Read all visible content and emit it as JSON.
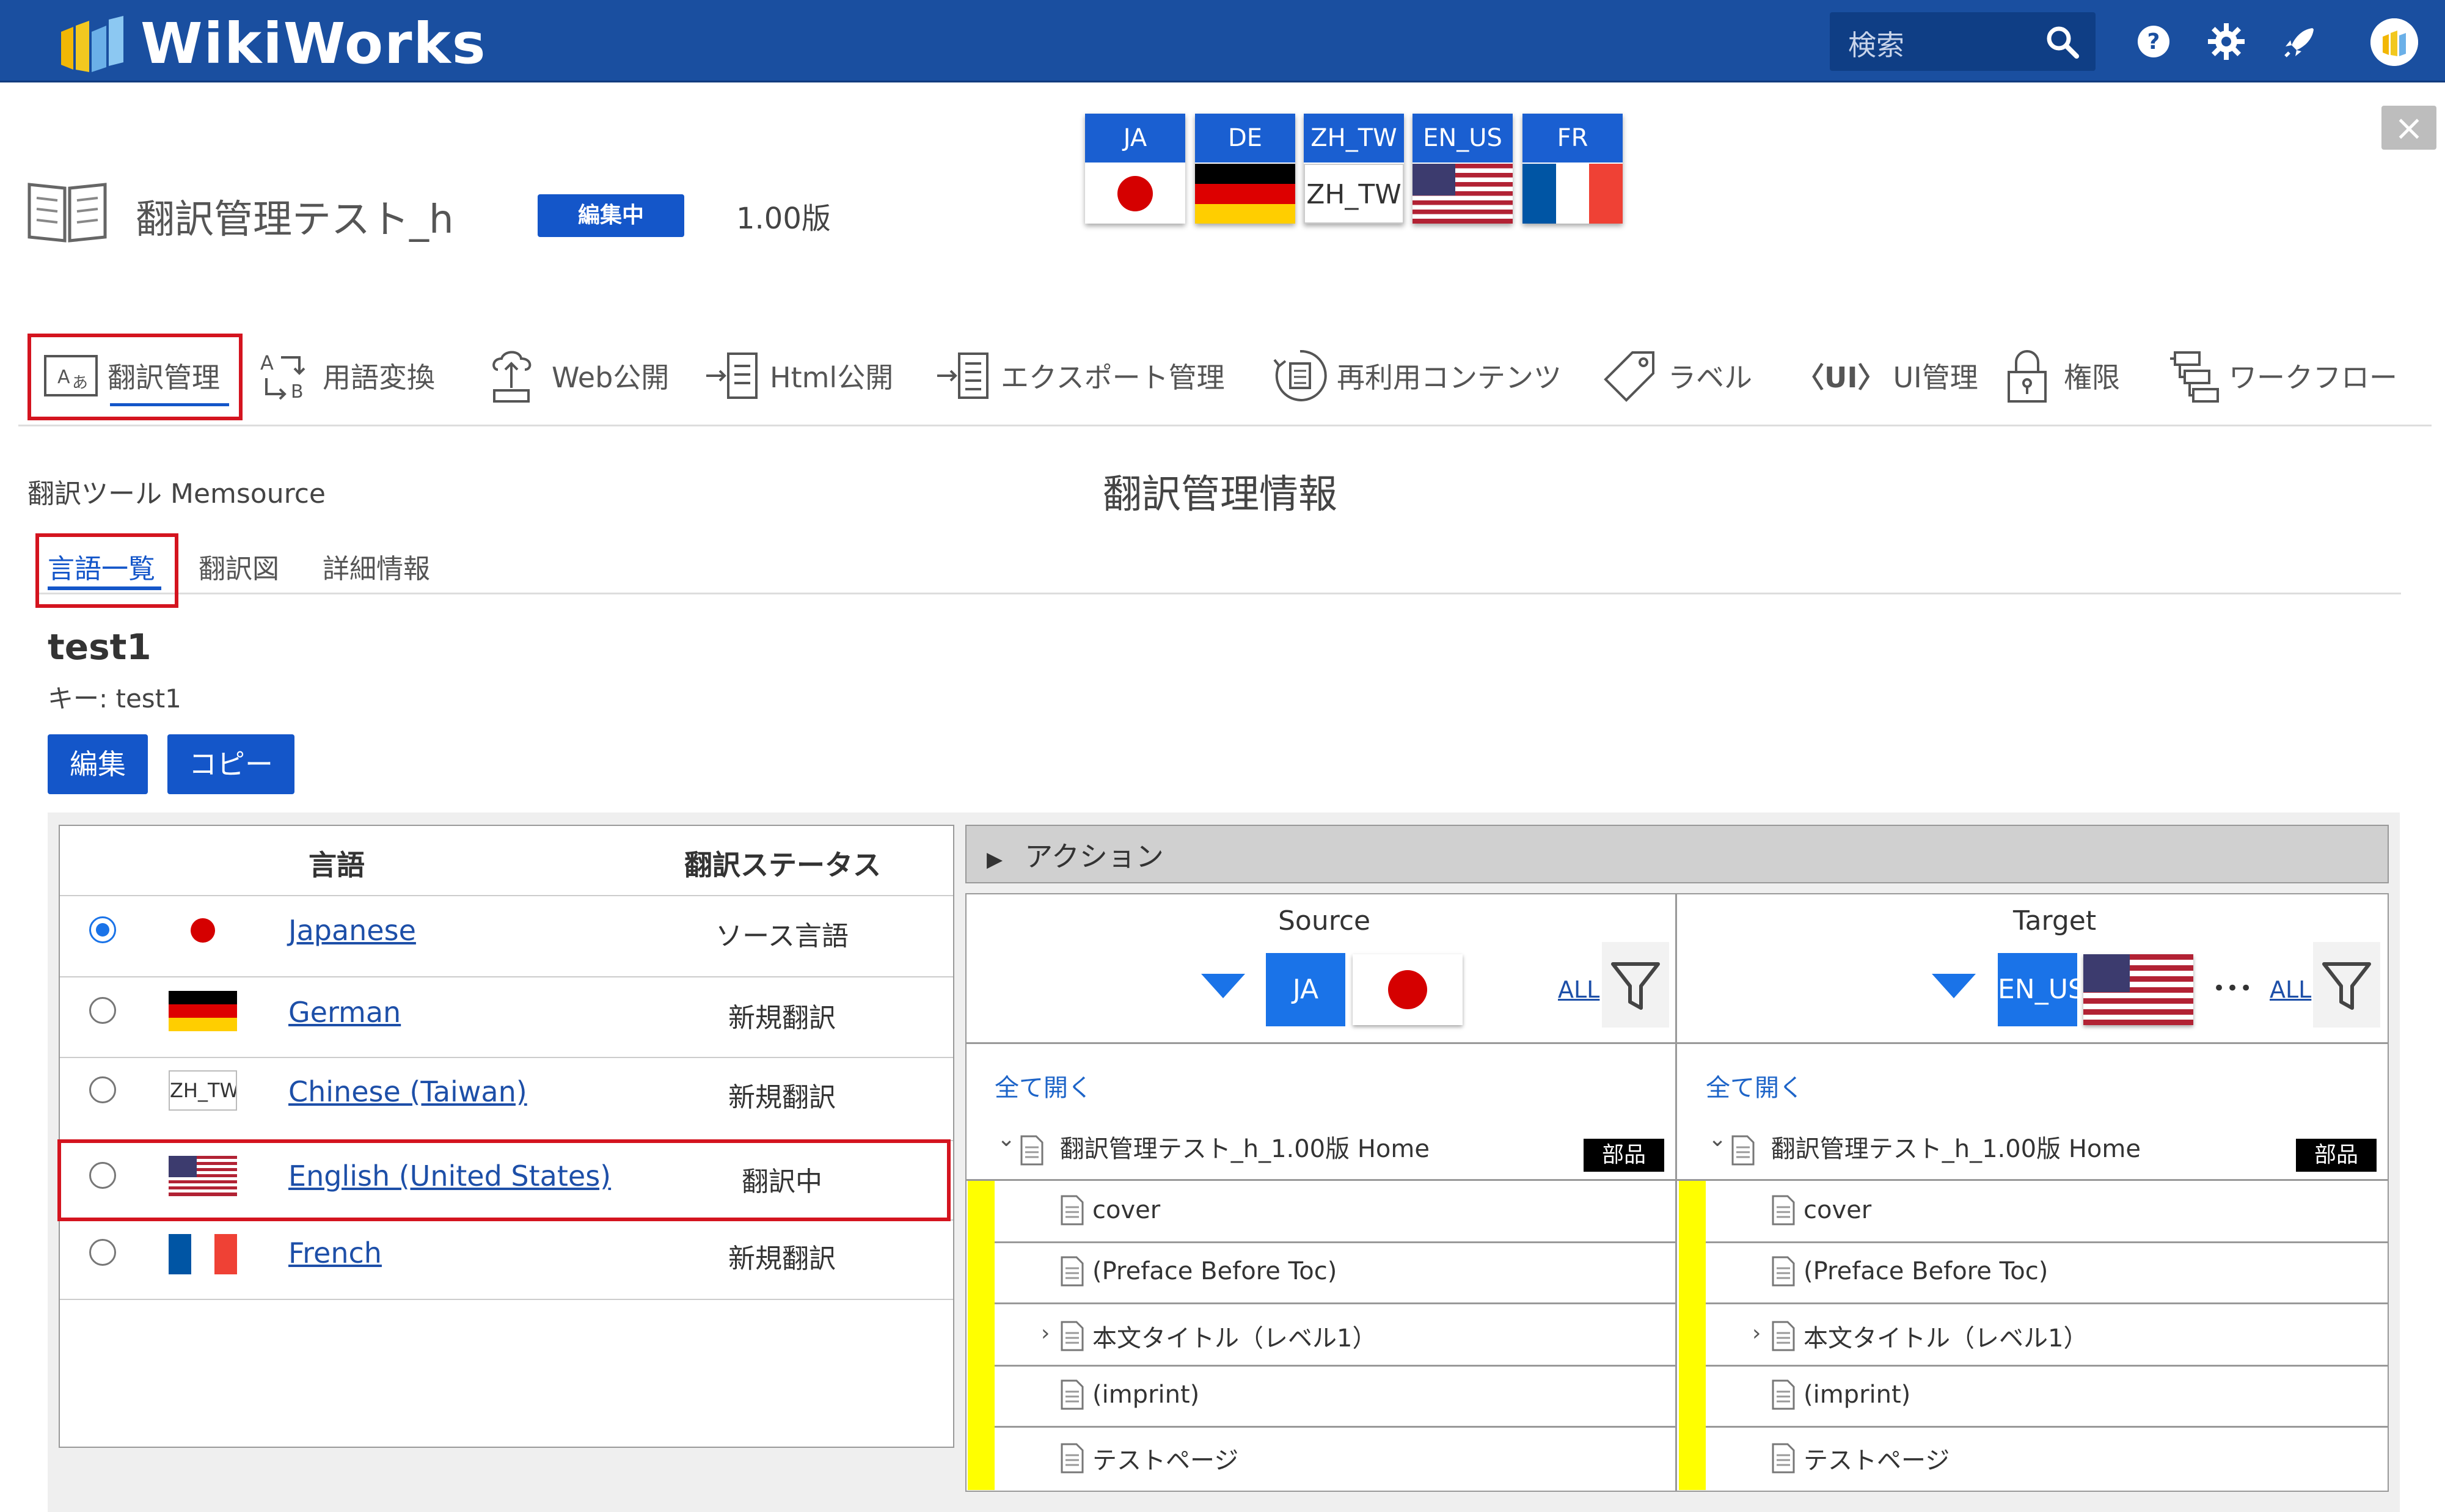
{
  "header": {
    "logo_text": "WikiWorks",
    "search_placeholder": "検索"
  },
  "doc": {
    "title": "翻訳管理テスト_h",
    "status_badge": "編集中",
    "version": "1.00版"
  },
  "languages_tabs": [
    {
      "code": "JA"
    },
    {
      "code": "DE"
    },
    {
      "code": "ZH_TW",
      "flag_text": "ZH_TW"
    },
    {
      "code": "EN_US"
    },
    {
      "code": "FR"
    }
  ],
  "nav": [
    {
      "label": "翻訳管理",
      "icon": "translate-icon"
    },
    {
      "label": "用語変換",
      "icon": "term-convert-icon"
    },
    {
      "label": "Web公開",
      "icon": "web-publish-icon"
    },
    {
      "label": "Html公開",
      "icon": "html-publish-icon"
    },
    {
      "label": "エクスポート管理",
      "icon": "export-icon"
    },
    {
      "label": "再利用コンテンツ",
      "icon": "reuse-icon"
    },
    {
      "label": "ラベル",
      "icon": "label-icon"
    },
    {
      "label": "UI管理",
      "icon": "ui-icon",
      "icon_text": "〈UI〉"
    },
    {
      "label": "権限",
      "icon": "lock-icon"
    },
    {
      "label": "ワークフロー",
      "icon": "workflow-icon"
    }
  ],
  "info": {
    "tool_label": "翻訳ツール Memsource",
    "title": "翻訳管理情報",
    "subtabs": [
      "言語一覧",
      "翻訳図",
      "詳細情報"
    ],
    "item_name": "test1",
    "item_key": "キー: test1",
    "edit_button": "編集",
    "copy_button": "コピー"
  },
  "lang_table": {
    "col_language": "言語",
    "col_status": "翻訳ステータス",
    "rows": [
      {
        "name": "Japanese",
        "status": "ソース言語",
        "selected": true
      },
      {
        "name": "German",
        "status": "新規翻訳",
        "selected": false
      },
      {
        "name": "Chinese (Taiwan)",
        "status": "新規翻訳",
        "selected": false,
        "flag_text": "ZH_TW"
      },
      {
        "name": "English (United States)",
        "status": "翻訳中",
        "selected": false
      },
      {
        "name": "French",
        "status": "新規翻訳",
        "selected": false
      }
    ]
  },
  "action": {
    "label": "アクション",
    "toggle": "▶"
  },
  "compare": {
    "source": {
      "heading": "Source",
      "code": "JA",
      "all_link": "ALL"
    },
    "target": {
      "heading": "Target",
      "code": "EN_US",
      "all_link": "ALL",
      "more": "•••"
    },
    "expand_all": "全て開く",
    "root": "翻訳管理テスト_h_1.00版 Home",
    "badge": "部品",
    "items": [
      "cover",
      "(Preface Before Toc)",
      "本文タイトル（レベル1）",
      "(imprint)",
      "テストページ"
    ]
  },
  "colors": {
    "header_bg": "#1a4fa0",
    "accent": "#1456c9",
    "highlight": "#d4141f",
    "yellow": "#ffff00"
  }
}
